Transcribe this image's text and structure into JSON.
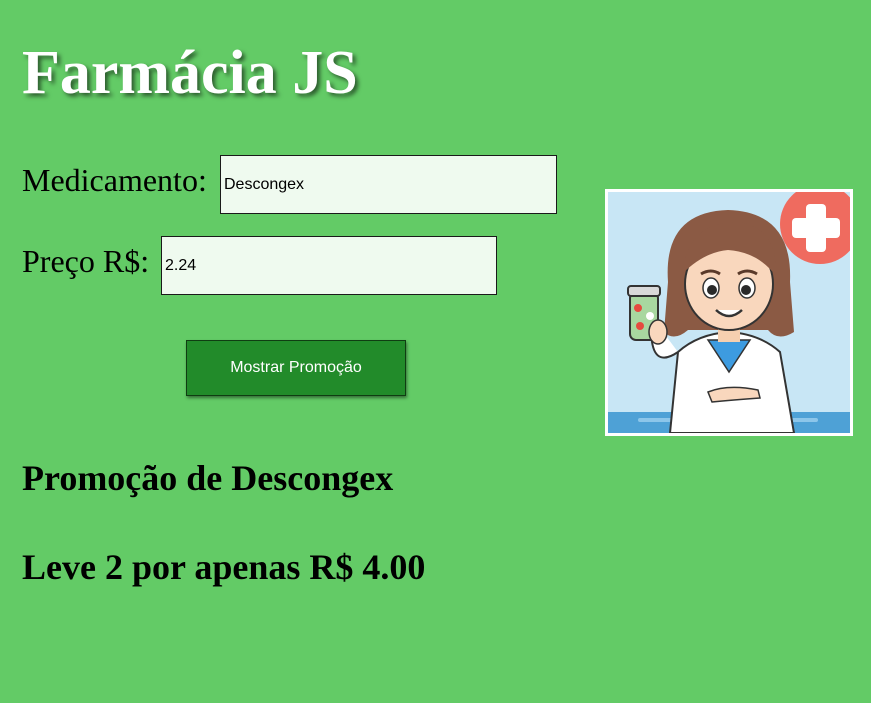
{
  "page": {
    "title": "Farmácia JS",
    "background_color": "#63cb66"
  },
  "form": {
    "medicamento_label": "Medicamento:",
    "medicamento_value": "Descongex",
    "preco_label": "Preço R$:",
    "preco_value": "2.24",
    "button_label": "Mostrar Promoção",
    "button_color": "#228b2a"
  },
  "result": {
    "title": "Promoção de Descongex",
    "offer": "Leve 2 por apenas R$ 4.00"
  },
  "illustration": {
    "subject": "pharmacist-woman-holding-pill-bottle",
    "badge_icon": "red-cross-icon"
  }
}
